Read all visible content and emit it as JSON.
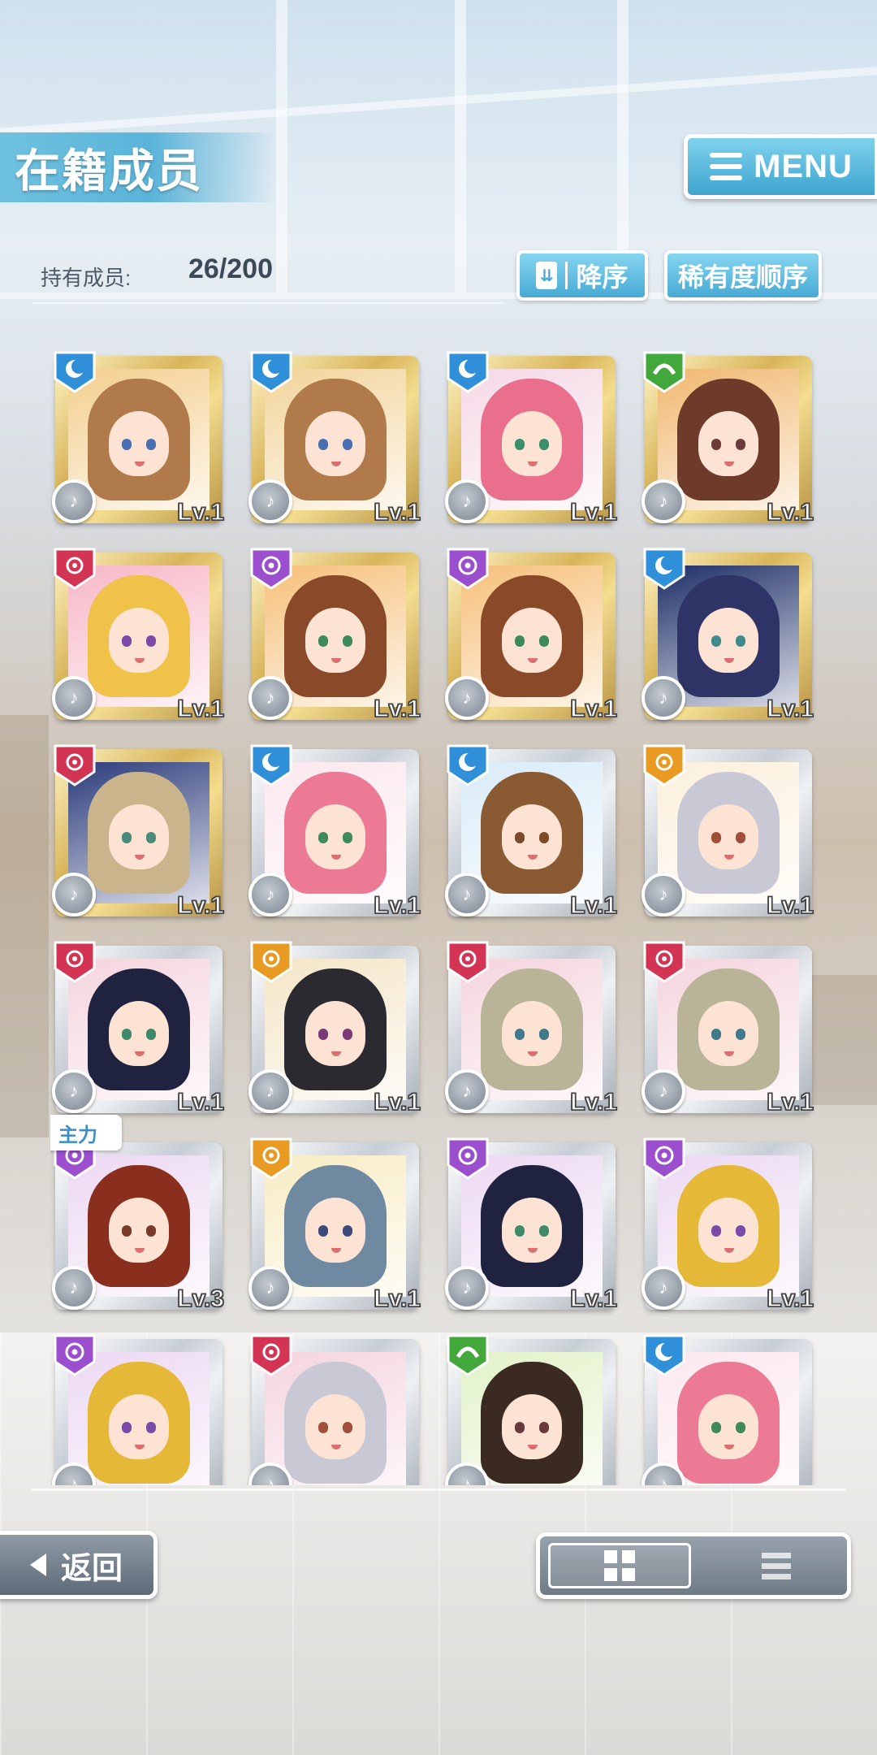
{
  "header": {
    "title": "在籍成员",
    "menu_label": "MENU"
  },
  "holdings": {
    "label": "持有成员:",
    "count": "26/200"
  },
  "sort": {
    "order_label": "降序",
    "key_label": "稀有度顺序"
  },
  "leader_badge": "主力",
  "members": [
    {
      "level": "Lv.1",
      "frame": "gold",
      "attr": "moon",
      "attr_color": "#2f8fd8",
      "hair": "#b07a4a",
      "eye": "#4a6fb0",
      "bg": "#f3cf8e"
    },
    {
      "level": "Lv.1",
      "frame": "gold",
      "attr": "moon",
      "attr_color": "#2f8fd8",
      "hair": "#b07a4a",
      "eye": "#4a6fb0",
      "bg": "#f2d49a"
    },
    {
      "level": "Lv.1",
      "frame": "gold",
      "attr": "moon",
      "attr_color": "#2f8fd8",
      "hair": "#ea6f8c",
      "eye": "#3b8f6a",
      "bg": "#f5d9e6"
    },
    {
      "level": "Lv.1",
      "frame": "gold",
      "attr": "wave",
      "attr_color": "#43a83b",
      "hair": "#6e3b2a",
      "eye": "#6d3a3a",
      "bg": "#f0b870"
    },
    {
      "level": "Lv.1",
      "frame": "gold",
      "attr": "sun-red",
      "attr_color": "#d43454",
      "hair": "#f0c24a",
      "eye": "#7a4aa8",
      "bg": "#f7b7c7"
    },
    {
      "level": "Lv.1",
      "frame": "gold",
      "attr": "flower",
      "attr_color": "#9b4fcf",
      "hair": "#8a4a2a",
      "eye": "#3d8a5a",
      "bg": "#f6c07a"
    },
    {
      "level": "Lv.1",
      "frame": "gold",
      "attr": "flower",
      "attr_color": "#9b4fcf",
      "hair": "#8a4a2a",
      "eye": "#3d8a5a",
      "bg": "#f6c07a"
    },
    {
      "level": "Lv.1",
      "frame": "gold",
      "attr": "moon",
      "attr_color": "#2f8fd8",
      "hair": "#2e3566",
      "eye": "#3f8a8a",
      "bg": "#1d2e66"
    },
    {
      "level": "Lv.1",
      "frame": "gold",
      "attr": "sun-red",
      "attr_color": "#d43454",
      "hair": "#c9b48c",
      "eye": "#4a8a7a",
      "bg": "#2a3a7a"
    },
    {
      "level": "Lv.1",
      "frame": "silver",
      "attr": "moon",
      "attr_color": "#2f8fd8",
      "hair": "#ec7a94",
      "eye": "#3f8a5a",
      "bg": "#fce8ef"
    },
    {
      "level": "Lv.1",
      "frame": "silver",
      "attr": "moon",
      "attr_color": "#2f8fd8",
      "hair": "#8a5a33",
      "eye": "#7a4a2a",
      "bg": "#d9ecf8"
    },
    {
      "level": "Lv.1",
      "frame": "silver",
      "attr": "sun",
      "attr_color": "#e89a22",
      "hair": "#c9c9d6",
      "eye": "#a0503a",
      "bg": "#fbf0dc"
    },
    {
      "level": "Lv.1",
      "frame": "silver",
      "attr": "sun-red",
      "attr_color": "#d43454",
      "hair": "#1f2340",
      "eye": "#3f8a6a",
      "bg": "#f5d4de"
    },
    {
      "level": "Lv.1",
      "frame": "silver",
      "attr": "sun",
      "attr_color": "#e89a22",
      "hair": "#2a2a30",
      "eye": "#7a3a7a",
      "bg": "#f4e6c6"
    },
    {
      "level": "Lv.1",
      "frame": "silver",
      "attr": "sun-red",
      "attr_color": "#d43454",
      "hair": "#b9b497",
      "eye": "#3f7a8a",
      "bg": "#f5d4de"
    },
    {
      "level": "Lv.1",
      "frame": "silver",
      "attr": "sun-red",
      "attr_color": "#d43454",
      "hair": "#b9b497",
      "eye": "#3f7a8a",
      "bg": "#f5d4de"
    },
    {
      "level": "Lv.3",
      "frame": "silver",
      "attr": "flower",
      "attr_color": "#9b4fcf",
      "hair": "#8a2e1e",
      "eye": "#7a3a2a",
      "bg": "#ecd8f2",
      "leader": true
    },
    {
      "level": "Lv.1",
      "frame": "silver",
      "attr": "sun",
      "attr_color": "#e89a22",
      "hair": "#6f8aa0",
      "eye": "#3a4a7a",
      "bg": "#f8ecc4"
    },
    {
      "level": "Lv.1",
      "frame": "silver",
      "attr": "flower",
      "attr_color": "#9b4fcf",
      "hair": "#1f2340",
      "eye": "#3f8a6a",
      "bg": "#ecd8f2"
    },
    {
      "level": "Lv.1",
      "frame": "silver",
      "attr": "flower",
      "attr_color": "#9b4fcf",
      "hair": "#e6b838",
      "eye": "#7a4aa8",
      "bg": "#ecd8f2"
    },
    {
      "level": "",
      "frame": "silver",
      "attr": "flower",
      "attr_color": "#9b4fcf",
      "hair": "#e6b838",
      "eye": "#7a4aa8",
      "bg": "#ecd8f2"
    },
    {
      "level": "",
      "frame": "silver",
      "attr": "sun-red",
      "attr_color": "#d43454",
      "hair": "#c9c9d6",
      "eye": "#a0503a",
      "bg": "#f5d4de"
    },
    {
      "level": "",
      "frame": "silver",
      "attr": "wave",
      "attr_color": "#43a83b",
      "hair": "#3a2a22",
      "eye": "#6a3a3a",
      "bg": "#e2f2c8"
    },
    {
      "level": "",
      "frame": "silver",
      "attr": "moon",
      "attr_color": "#2f8fd8",
      "hair": "#ec7a94",
      "eye": "#3f8a5a",
      "bg": "#fce8ef"
    }
  ],
  "back_label": "返回",
  "view_toggle": {
    "selected": "grid",
    "options": [
      "grid-view-icon",
      "list-view-icon"
    ]
  }
}
